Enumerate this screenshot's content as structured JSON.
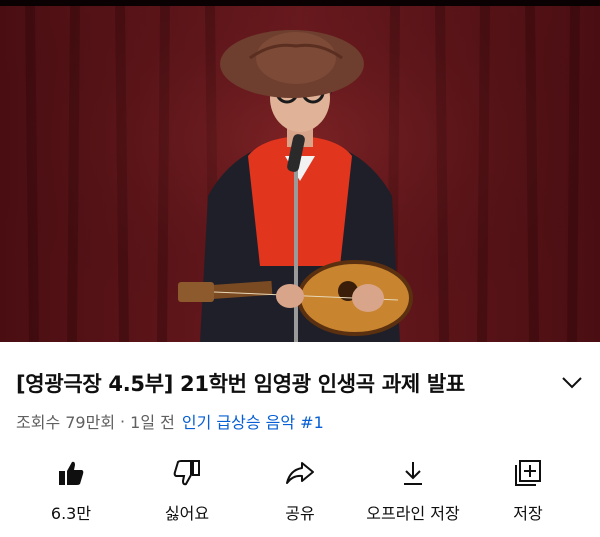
{
  "video": {
    "title": "[영광극장 4.5부] 21학번 임영광 인생곡 과제 발표",
    "views": "조회수 79만회",
    "separator": "·",
    "age": "1일 전",
    "trending": "인기 급상승 음악 #1"
  },
  "actions": [
    {
      "label": "6.3만",
      "icon": "thumbs-up-icon"
    },
    {
      "label": "싫어요",
      "icon": "thumbs-down-icon"
    },
    {
      "label": "공유",
      "icon": "share-icon"
    },
    {
      "label": "오프라인 저장",
      "icon": "download-icon"
    },
    {
      "label": "저장",
      "icon": "add-to-playlist-icon"
    }
  ],
  "colors": {
    "curtain": "#5a1418",
    "link": "#065fd4",
    "meta_text": "#606060"
  }
}
